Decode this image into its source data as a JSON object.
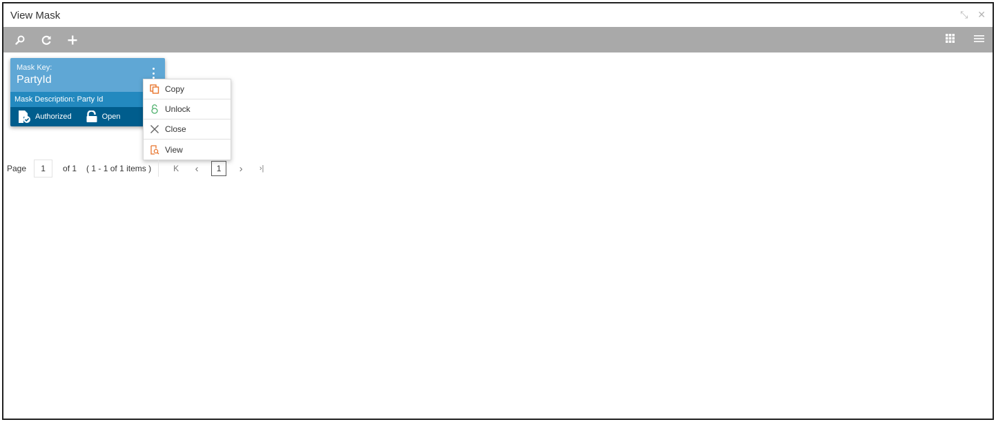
{
  "window": {
    "title": "View Mask",
    "minimize_glyph": "⤡",
    "close_glyph": "✕"
  },
  "toolbar": {
    "left_icons": [
      "search-icon",
      "refresh-icon",
      "add-icon"
    ],
    "right_icons": [
      "grid-view-icon",
      "list-view-icon"
    ]
  },
  "tile": {
    "key_label": "Mask Key:",
    "key_value": "PartyId",
    "description_label": "Mask Description:",
    "description_value": "Party Id",
    "auth_status": "Authorized",
    "record_status": "Open",
    "colors": {
      "top": "#5fa7d5",
      "middle": "#2389bf",
      "bottom": "#005d8d"
    }
  },
  "context_menu": {
    "items": [
      {
        "label": "Copy",
        "icon": "copy-icon",
        "icon_color": "#e8742c"
      },
      {
        "label": "Unlock",
        "icon": "unlock-icon",
        "icon_color": "#4caf6a"
      },
      {
        "label": "Close",
        "icon": "close-icon",
        "icon_color": "#666666"
      },
      {
        "label": "View",
        "icon": "view-icon",
        "icon_color": "#e8742c"
      }
    ]
  },
  "pager": {
    "page_label": "Page",
    "page_value": "1",
    "of_label": "of 1",
    "items_label": "( 1 - 1 of 1 items )",
    "current_page": "1",
    "first": "K",
    "prev": "‹",
    "next": "›",
    "last": "›|"
  }
}
